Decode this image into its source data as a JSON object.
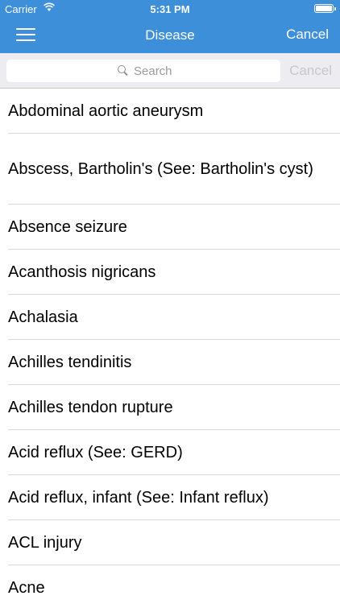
{
  "status_bar": {
    "carrier": "Carrier",
    "time": "5:31 PM"
  },
  "nav": {
    "title": "Disease",
    "cancel_label": "Cancel"
  },
  "search": {
    "placeholder": "Search",
    "cancel_label": "Cancel"
  },
  "list": {
    "items": [
      {
        "label": "Abdominal aortic aneurysm"
      },
      {
        "label": "Abscess, Bartholin's (See: Bartholin's cyst)"
      },
      {
        "label": "Absence seizure"
      },
      {
        "label": "Acanthosis nigricans"
      },
      {
        "label": "Achalasia"
      },
      {
        "label": "Achilles tendinitis"
      },
      {
        "label": "Achilles tendon rupture"
      },
      {
        "label": "Acid reflux (See: GERD)"
      },
      {
        "label": "Acid reflux, infant (See: Infant reflux)"
      },
      {
        "label": "ACL injury"
      },
      {
        "label": "Acne"
      }
    ]
  },
  "colors": {
    "nav_background": "#3d8fd9",
    "search_background": "#ececf1",
    "disabled_text": "#c7c7cc"
  }
}
